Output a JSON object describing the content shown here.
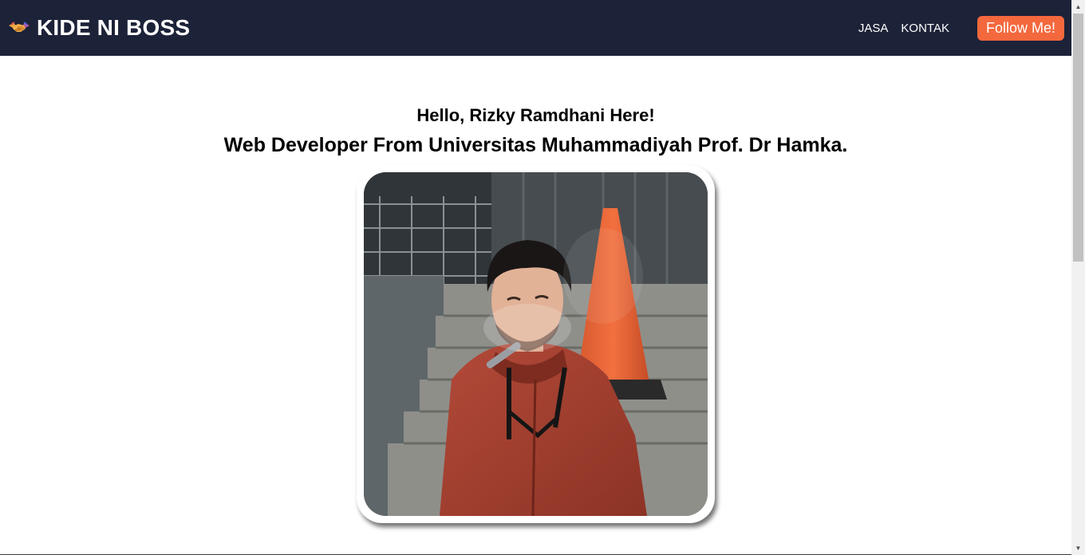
{
  "navbar": {
    "brand_icon": "handshake-icon",
    "brand_title": "KIDE NI BOSS",
    "links": [
      "JASA",
      "KONTAK"
    ],
    "follow_label": "Follow Me!",
    "colors": {
      "background": "#1c2238",
      "accent": "#f4683d"
    }
  },
  "hero": {
    "greeting": "Hello, Rizky Ramdhani Here!",
    "role": "Web Developer From Universitas Muhammadiyah Prof. Dr Hamka."
  },
  "scrollbar": {
    "up_icon": "scroll-up-arrow-icon",
    "down_icon": "scroll-down-arrow-icon"
  }
}
